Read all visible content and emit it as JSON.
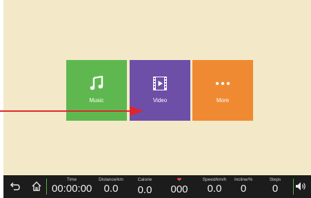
{
  "tiles": [
    {
      "label": "Music",
      "icon": "music-note-icon",
      "color": "#5fb84f"
    },
    {
      "label": "Video",
      "icon": "film-icon",
      "color": "#6e4fa7"
    },
    {
      "label": "More",
      "icon": "more-dots-icon",
      "color": "#f08a32"
    }
  ],
  "annotation": {
    "icon": "red-arrow-icon",
    "color": "#e0242b"
  },
  "bottombar": {
    "back_icon": "back-arrow-icon",
    "home_icon": "home-icon",
    "volume_icon": "volume-icon",
    "metrics": {
      "time": {
        "caption": "Time",
        "value": "00:00:00"
      },
      "distance": {
        "caption": "Distance/km",
        "value": "0.0"
      },
      "calorie": {
        "caption": "Calorie",
        "value": "0.0"
      },
      "heart": {
        "icon": "heart-icon",
        "value": "000"
      },
      "speed": {
        "caption": "Speed/km/h",
        "value": "0.0"
      },
      "incline": {
        "caption": "Incline/%",
        "value": "0"
      },
      "steps": {
        "caption": "Steps",
        "value": "0"
      }
    }
  }
}
